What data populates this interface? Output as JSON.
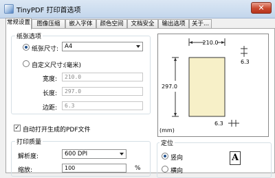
{
  "window": {
    "title": "TinyPDF 打印首选项",
    "close_glyph": "✕"
  },
  "tabs": [
    {
      "label": "常规设置",
      "active": true
    },
    {
      "label": "图像压缩"
    },
    {
      "label": "嵌入字体"
    },
    {
      "label": "颜色空间"
    },
    {
      "label": "文档安全"
    },
    {
      "label": "输出选项"
    },
    {
      "label": "关于..."
    }
  ],
  "paper": {
    "group_title": "纸张选项",
    "size_radio_label": "纸张尺寸:",
    "size_value": "A4",
    "custom_radio_label": "自定义尺寸:",
    "custom_unit": "(毫米)",
    "width_label": "宽度:",
    "width_value": "210.0",
    "height_label": "长度:",
    "height_value": "297.0",
    "margin_label": "边距:",
    "margin_value": "6.3"
  },
  "auto_open": {
    "label": "自动打开生成的PDF文件",
    "checked": true
  },
  "quality": {
    "group_title": "打印质量",
    "resolution_label": "解析度:",
    "resolution_value": "600 DPI",
    "scale_label": "缩放:",
    "scale_value": "100",
    "scale_unit": "%"
  },
  "preview": {
    "width_dim": "210.0",
    "height_dim": "297.0",
    "margin_top": "6.3",
    "margin_bottom": "6.3",
    "unit": "(mm)"
  },
  "orientation": {
    "group_title": "定位",
    "portrait_label": "竖向",
    "landscape_label": "横向",
    "icon_letter": "A"
  },
  "colors": {
    "titlebar": "#c3d6ec",
    "close": "#c9492f",
    "paper_fill": "#f7f0c8",
    "selected_radio": "#1f4f8c"
  }
}
